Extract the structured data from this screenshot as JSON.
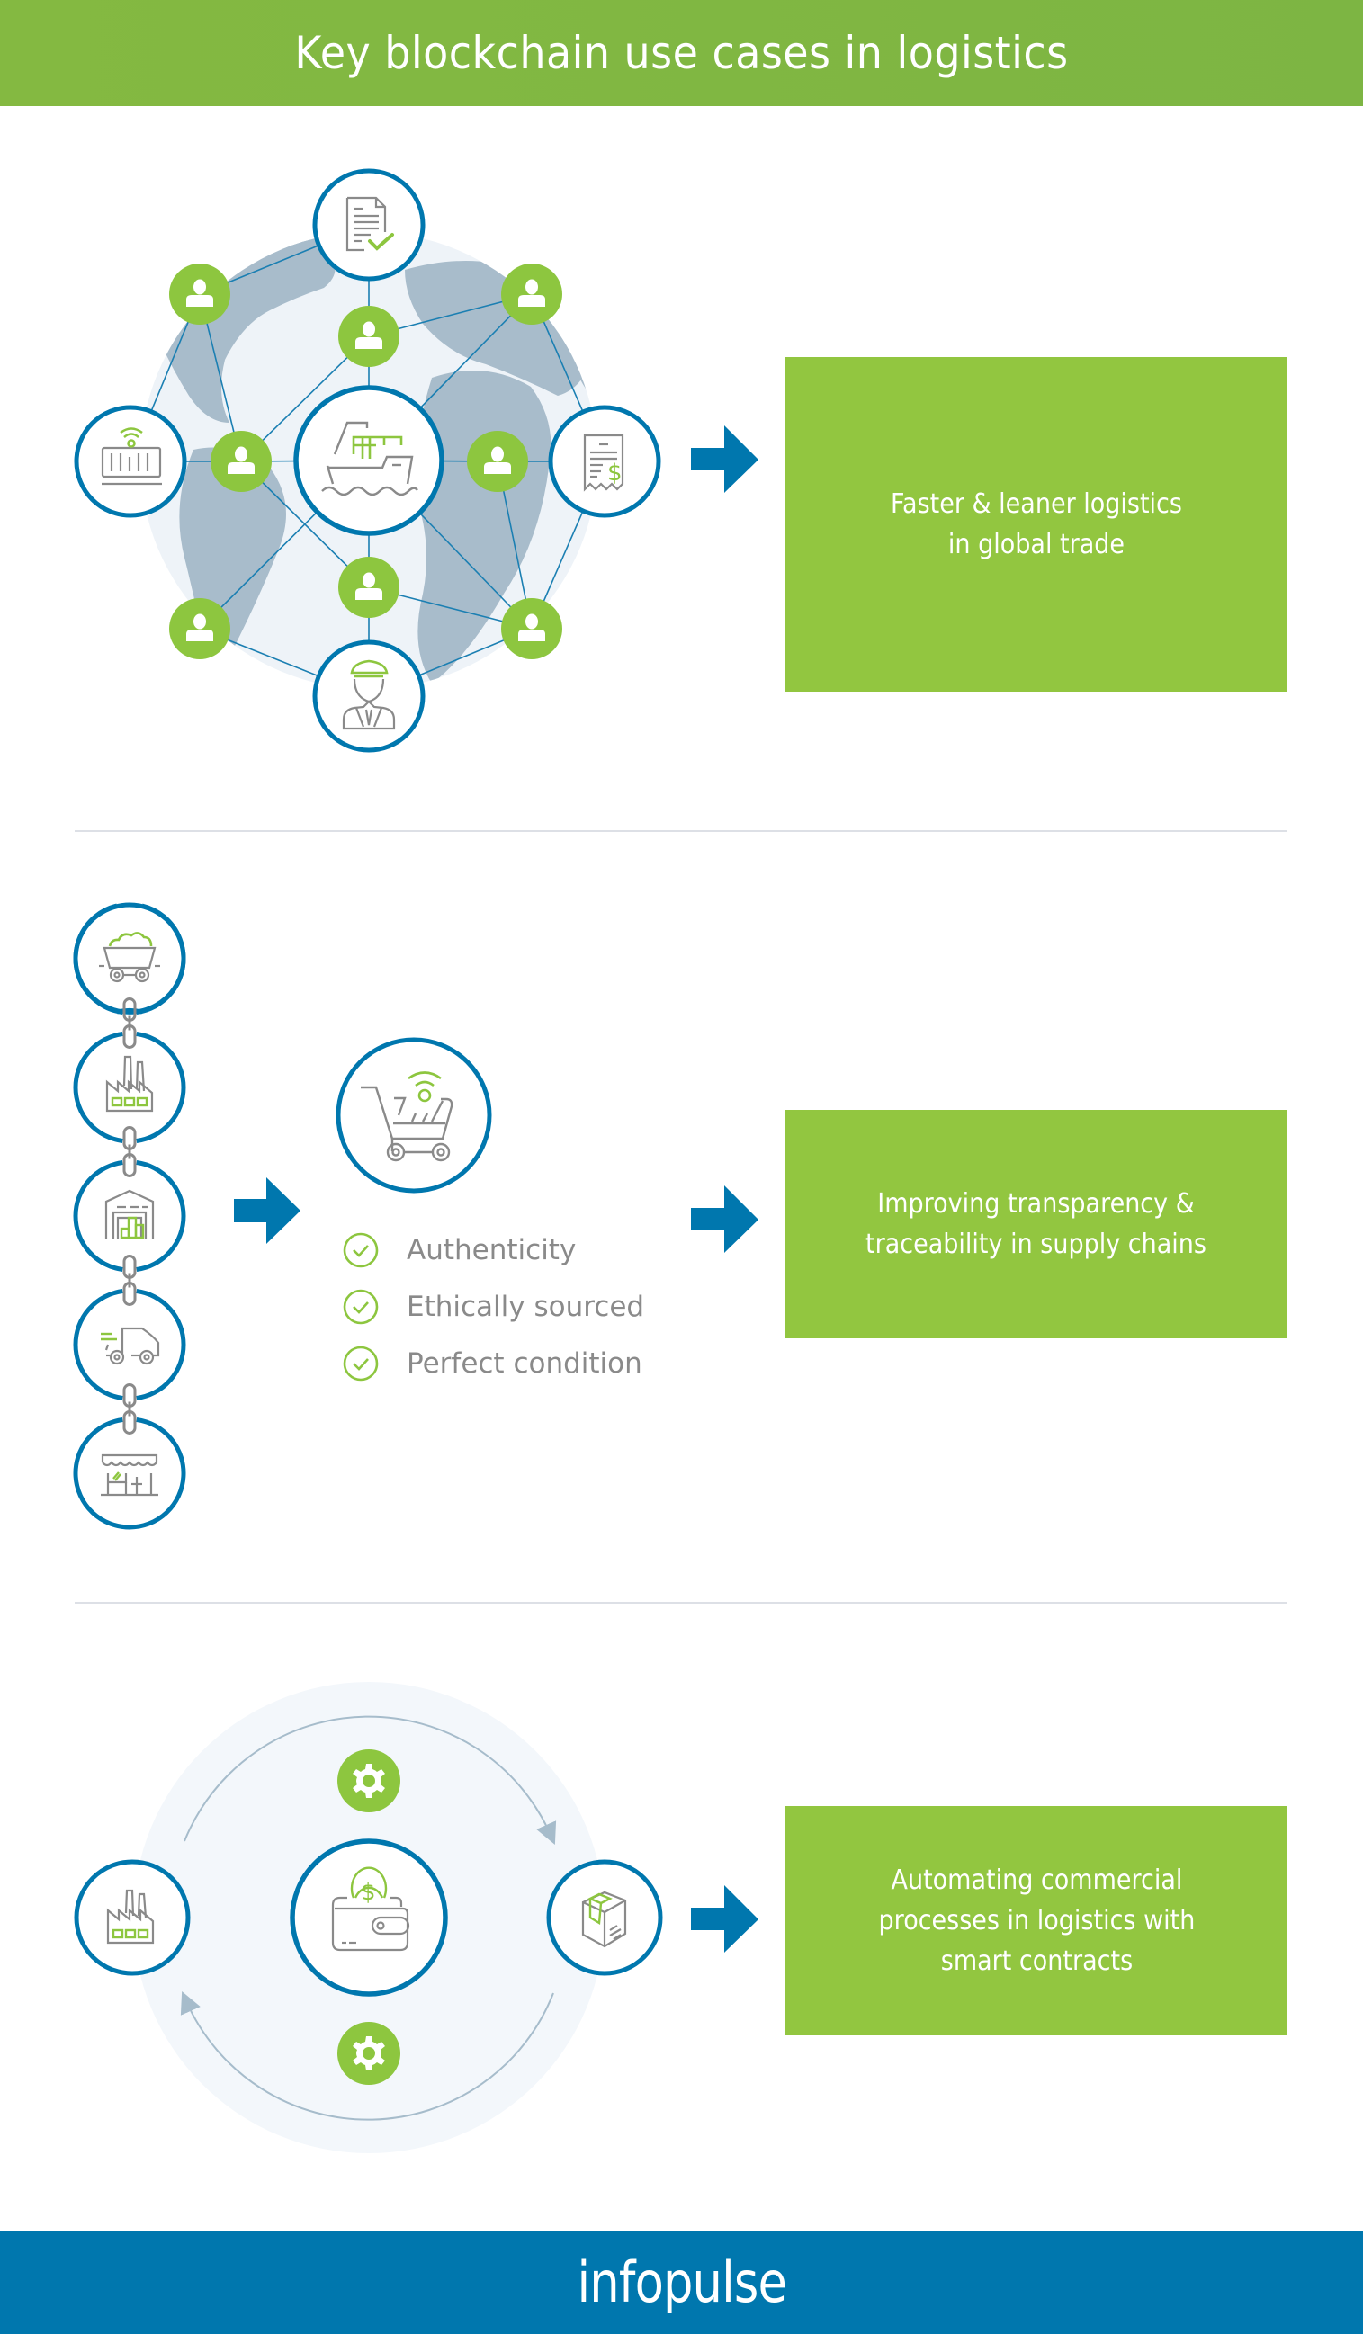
{
  "header": {
    "title": "Key blockchain use cases in logistics"
  },
  "colors": {
    "header_green": "#7db543",
    "box_green": "#92c640",
    "node_green": "#8dc63f",
    "accent_blue": "#0077ae",
    "icon_gray": "#8a8a8a",
    "globe_land": "#a8bccb",
    "globe_water": "#eef3f8",
    "divider": "#dde0e6"
  },
  "sections": [
    {
      "name": "global-trade",
      "diagram": {
        "center_icon": "cargo-ship-icon",
        "outer_icons": [
          "document-check-icon",
          "iot-container-icon",
          "invoice-dollar-icon",
          "captain-icon"
        ],
        "participant_icon": "user-icon",
        "participant_count": 8
      },
      "outcome": "Faster & leaner logistics\nin global trade"
    },
    {
      "name": "supply-chain",
      "chain_icons": [
        "mine-cart-icon",
        "factory-icon",
        "warehouse-icon",
        "delivery-truck-icon",
        "store-icon"
      ],
      "product_icon": "smart-cart-icon",
      "checks": [
        "Authenticity",
        "Ethically sourced",
        "Perfect condition"
      ],
      "outcome": "Improving transparency &\ntraceability in supply chains"
    },
    {
      "name": "smart-contracts",
      "left_icon": "factory-icon",
      "center_icon": "wallet-dollar-icon",
      "right_icon": "package-icon",
      "process_icon": "gear-icon",
      "outcome": "Automating commercial\nprocesses in logistics with\nsmart contracts"
    }
  ],
  "footer": {
    "logo": "infopulse"
  }
}
